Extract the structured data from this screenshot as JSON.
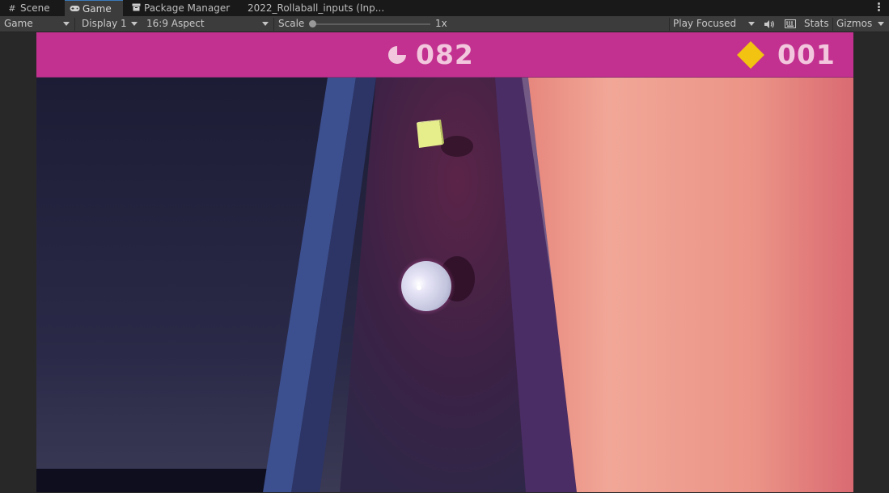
{
  "tabs": [
    {
      "label": "Scene",
      "icon": "grid-icon"
    },
    {
      "label": "Game",
      "icon": "gamepad-icon"
    },
    {
      "label": "Package Manager",
      "icon": "package-icon"
    },
    {
      "label": "2022_Rollaball_inputs (Inp..."
    }
  ],
  "toolbar": {
    "view_mode": "Game",
    "display": "Display 1",
    "aspect": "16:9 Aspect",
    "scale_label": "Scale",
    "scale_value": "1x",
    "play_mode": "Play Focused",
    "stats": "Stats",
    "gizmos": "Gizmos"
  },
  "hud": {
    "score": "082",
    "collected": "001",
    "colors": {
      "bar": "#c2318f",
      "text": "#f2c7dd",
      "diamond": "#f2c311"
    }
  }
}
